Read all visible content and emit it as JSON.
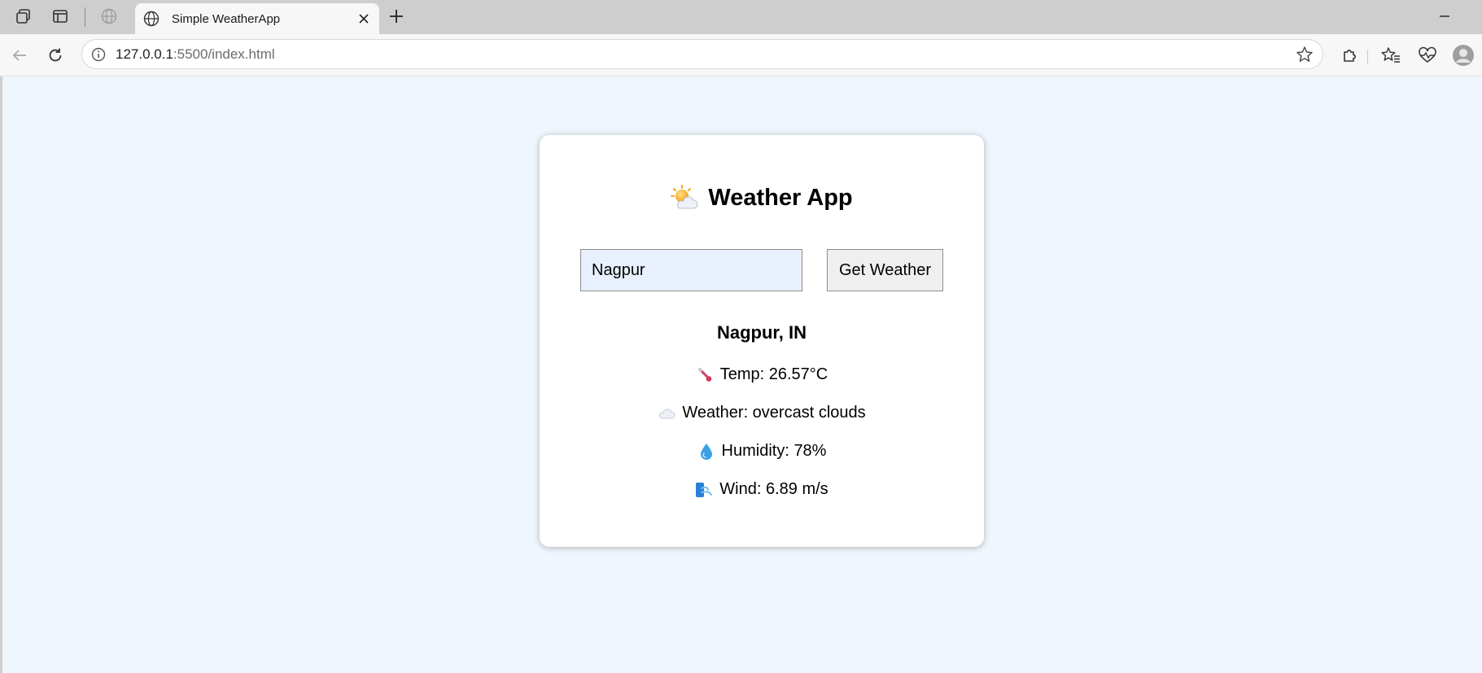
{
  "browser": {
    "tab": {
      "title": "Simple WeatherApp"
    },
    "address": {
      "host": "127.0.0.1",
      "rest": ":5500/index.html"
    }
  },
  "app": {
    "title": "Weather App",
    "search": {
      "value": "Nagpur",
      "button_label": "Get Weather"
    },
    "result": {
      "city": "Nagpur, IN",
      "temp": "Temp: 26.57°C",
      "weather": "Weather: overcast clouds",
      "humidity": "Humidity: 78%",
      "wind": "Wind: 6.89 m/s"
    }
  },
  "icons": {
    "title": "sun-behind-cloud-icon",
    "temp": "thermometer-icon",
    "weather": "cloud-icon",
    "humidity": "droplet-icon",
    "wind": "wind-icon"
  },
  "colors": {
    "page_background": "#eff6fd",
    "input_background": "#e8f0fe",
    "button_background": "#efefef"
  }
}
